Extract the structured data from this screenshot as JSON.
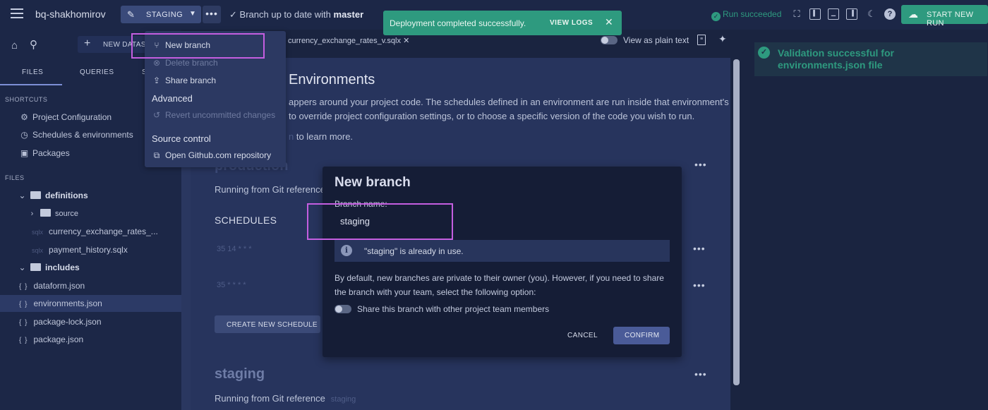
{
  "header": {
    "project": "bq-shakhomirov",
    "branch": "STAGING",
    "status_prefix": "Branch up to date with",
    "status_branch": "master",
    "run_status": "Run succeeded",
    "start_run": "START NEW RUN"
  },
  "toast": {
    "message": "Deployment completed successfully.",
    "action": "VIEW LOGS"
  },
  "sidebar": {
    "new_dataset": "NEW DATAS",
    "tabs": [
      "FILES",
      "QUERIES",
      "S"
    ],
    "shortcuts_title": "SHORTCUTS",
    "shortcuts": [
      "Project Configuration",
      "Schedules & environments",
      "Packages"
    ],
    "files_title": "FILES",
    "folders": {
      "definitions": "definitions",
      "source": "source",
      "includes": "includes"
    },
    "sqlx_tag": "sqlx",
    "definition_files": [
      "currency_exchange_rates_...",
      "payment_history.sqlx"
    ],
    "json_files": [
      "dataform.json",
      "environments.json",
      "package-lock.json",
      "package.json"
    ]
  },
  "dropdown": {
    "new_branch": "New branch",
    "delete_branch": "Delete branch",
    "share_branch": "Share branch",
    "advanced": "Advanced",
    "revert": "Revert uncommitted changes",
    "source_control": "Source control",
    "open_github": "Open Github.com repository"
  },
  "editor": {
    "open_tab": "currency_exchange_rates_v.sqlx",
    "view_plain": "View as plain text",
    "title": "Environments",
    "para1": "appers around your project code. The schedules defined in an environment are run inside that environment's",
    "para2": "to override project configuration settings, or to choose a specific version of the code you wish to run.",
    "para3_faded": "n",
    "para3": " to learn more.",
    "production_heading": "production",
    "running_from": "Running from Git reference",
    "schedules_title": "SCHEDULES",
    "cron1": "35 14 * * *",
    "cron2": "35 * * * *",
    "create_schedule": "CREATE NEW SCHEDULE",
    "staging_heading": "staging",
    "staging_ref": "staging"
  },
  "validation": {
    "message": "Validation successful for environments.json file"
  },
  "modal": {
    "title": "New branch",
    "label": "Branch name:",
    "input_value": "staging",
    "info": "\"staging\" is already in use.",
    "desc": "By default, new branches are private to their owner (you). However, if you need to share the branch with your team, select the following option:",
    "share_label": "Share this branch with other project team members",
    "cancel": "CANCEL",
    "confirm": "CONFIRM"
  },
  "colors": {
    "accent_green": "#2e9a7f",
    "highlight_magenta": "#c45ee0",
    "primary_button": "#4a5b98"
  },
  "icons": [
    "menu-icon",
    "pencil-icon",
    "caret-down-icon",
    "more-icon",
    "check-icon",
    "close-icon",
    "fullscreen-icon",
    "panel-left-icon",
    "panel-bottom-icon",
    "panel-right-icon",
    "moon-icon",
    "help-icon",
    "rocket-icon",
    "home-icon",
    "search-icon",
    "plus-icon",
    "gear-icon",
    "calendar-icon",
    "package-icon",
    "branch-icon",
    "delete-icon",
    "share-icon",
    "revert-icon",
    "external-link-icon",
    "info-icon",
    "file-icon",
    "sparkle-icon"
  ]
}
